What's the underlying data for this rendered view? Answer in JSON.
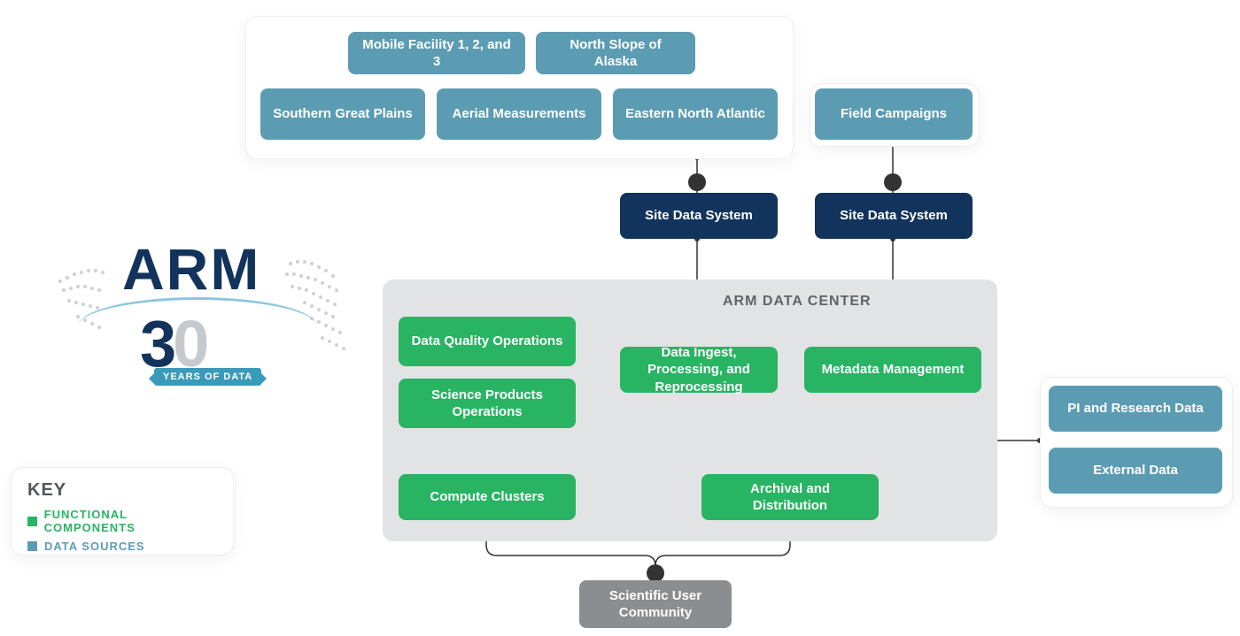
{
  "logo": {
    "brand": "ARM",
    "years": "30",
    "banner": "YEARS OF DATA"
  },
  "key": {
    "title": "KEY",
    "functional_label": "FUNCTIONAL COMPONENTS",
    "data_sources_label": "DATA SOURCES"
  },
  "sources_panel": {
    "mobile": "Mobile Facility 1, 2, and 3",
    "nsa": "North Slope of Alaska",
    "sgp": "Southern Great Plains",
    "aerial": "Aerial Measurements",
    "ena": "Eastern North Atlantic"
  },
  "field_campaigns": "Field Campaigns",
  "site_data_system_a": "Site Data System",
  "site_data_system_b": "Site Data System",
  "data_center": {
    "title": "ARM DATA CENTER",
    "dqo": "Data Quality Operations",
    "spo": "Science Products Operations",
    "ingest": "Data Ingest, Processing, and Reprocessing",
    "metadata": "Metadata Management",
    "compute": "Compute Clusters",
    "archival": "Archival and Distribution"
  },
  "external_panel": {
    "pi": "PI and Research Data",
    "external": "External Data"
  },
  "community": "Scientific User Community",
  "colors": {
    "data_source": "#5c9cb3",
    "functional": "#28b463",
    "navy": "#12335b",
    "grey_node": "#8b8e91",
    "panel_grey": "#e1e3e5"
  }
}
